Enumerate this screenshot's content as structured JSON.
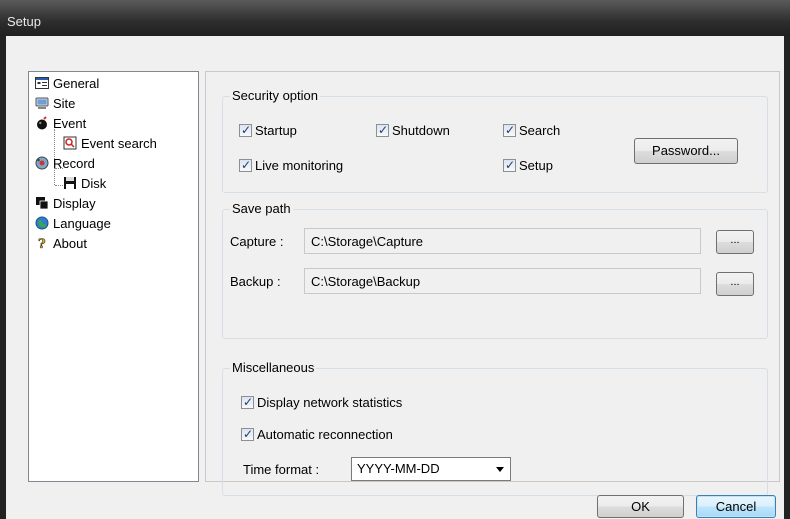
{
  "window": {
    "title": "Setup"
  },
  "tree": {
    "items": [
      {
        "label": "General",
        "icon": "general-icon"
      },
      {
        "label": "Site",
        "icon": "site-icon"
      },
      {
        "label": "Event",
        "icon": "event-icon"
      },
      {
        "label": "Event search",
        "icon": "event-search-icon"
      },
      {
        "label": "Record",
        "icon": "record-icon"
      },
      {
        "label": "Disk",
        "icon": "disk-icon"
      },
      {
        "label": "Display",
        "icon": "display-icon"
      },
      {
        "label": "Language",
        "icon": "language-icon"
      },
      {
        "label": "About",
        "icon": "about-icon"
      }
    ]
  },
  "security": {
    "title": "Security option",
    "options": {
      "startup": {
        "label": "Startup",
        "checked": true
      },
      "shutdown": {
        "label": "Shutdown",
        "checked": true
      },
      "search": {
        "label": "Search",
        "checked": true
      },
      "live": {
        "label": "Live monitoring",
        "checked": true
      },
      "setup": {
        "label": "Setup",
        "checked": true
      }
    },
    "password_button": "Password..."
  },
  "save_path": {
    "title": "Save path",
    "capture_label": "Capture :",
    "capture_value": "C:\\Storage\\Capture",
    "backup_label": "Backup :",
    "backup_value": "C:\\Storage\\Backup",
    "browse_label": "..."
  },
  "misc": {
    "title": "Miscellaneous",
    "network_stats": {
      "label": "Display network statistics",
      "checked": true
    },
    "auto_reconnect": {
      "label": "Automatic reconnection",
      "checked": true
    },
    "time_format_label": "Time format :",
    "time_format_value": "YYYY-MM-DD"
  },
  "footer": {
    "ok": "OK",
    "cancel": "Cancel"
  }
}
